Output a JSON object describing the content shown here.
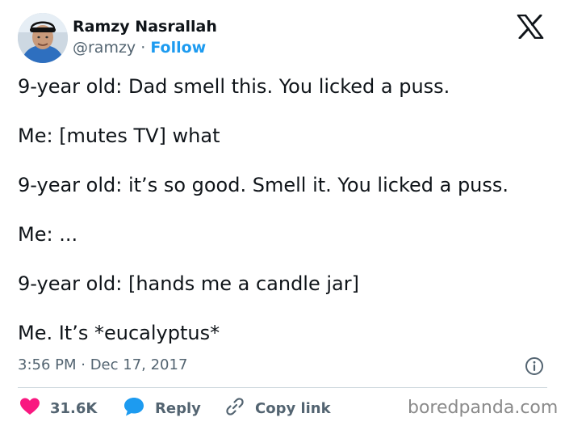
{
  "header": {
    "name": "Ramzy Nasrallah",
    "handle": "@ramzy",
    "separator": " · ",
    "follow_label": "Follow"
  },
  "tweet": {
    "lines": [
      "9-year old: Dad smell this. You licked a puss.",
      "Me: [mutes TV] what",
      "9-year old: it’s so good. Smell it. You licked a puss.",
      "Me: ...",
      "9-year old: [hands me a candle jar]",
      "Me. It’s *eucalyptus*"
    ],
    "timestamp": "3:56 PM · Dec 17, 2017"
  },
  "actions": {
    "like_count": "31.6K",
    "reply_label": "Reply",
    "copy_label": "Copy link"
  },
  "watermark": "boredpanda.com",
  "colors": {
    "accent": "#1d9bf0",
    "like": "#f91880",
    "text": "#0f1419",
    "muted": "#536471"
  },
  "icons": {
    "platform": "x-logo-icon",
    "info": "info-icon",
    "like": "heart-icon",
    "reply": "speech-bubble-icon",
    "copy": "link-icon"
  }
}
